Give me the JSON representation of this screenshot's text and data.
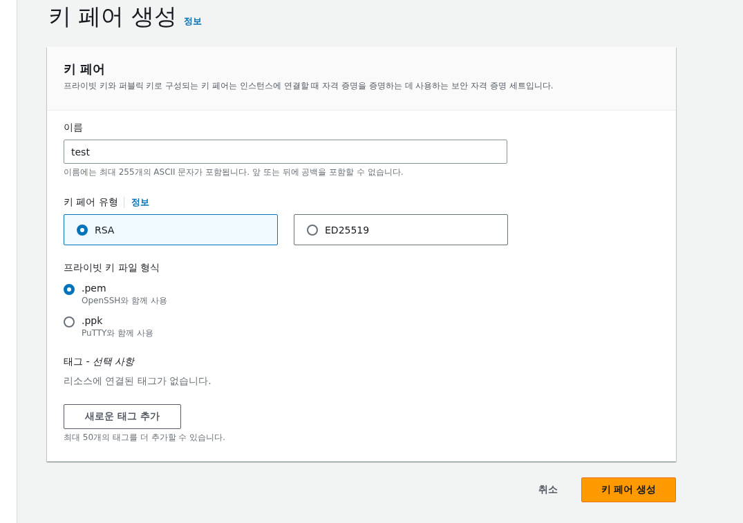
{
  "page": {
    "title": "키 페어 생성",
    "info_link": "정보"
  },
  "card": {
    "title": "키 페어",
    "description": "프라이빗 키와 퍼블릭 키로 구성되는 키 페어는 인스턴스에 연결할 때 자격 증명을 증명하는 데 사용하는 보안 자격 증명 세트입니다."
  },
  "name_field": {
    "label": "이름",
    "value": "test",
    "hint": "이름에는 최대 255개의 ASCII 문자가 포함됩니다. 앞 또는 뒤에 공백을 포함할 수 없습니다."
  },
  "key_type": {
    "label": "키 페어 유형",
    "info_link": "정보",
    "options": [
      {
        "label": "RSA",
        "selected": true
      },
      {
        "label": "ED25519",
        "selected": false
      }
    ]
  },
  "file_format": {
    "label": "프라이빗 키 파일 형식",
    "options": [
      {
        "label": ".pem",
        "description": "OpenSSH와 함께 사용",
        "selected": true
      },
      {
        "label": ".ppk",
        "description": "PuTTY와 함께 사용",
        "selected": false
      }
    ]
  },
  "tags": {
    "label": "태그 - *선택 사항*",
    "empty_text": "리소스에 연결된 태그가 없습니다.",
    "add_button": "새로운 태그 추가",
    "hint": "최대 50개의 태그를 더 추가할 수 있습니다."
  },
  "footer": {
    "cancel": "취소",
    "submit": "키 페어 생성"
  }
}
